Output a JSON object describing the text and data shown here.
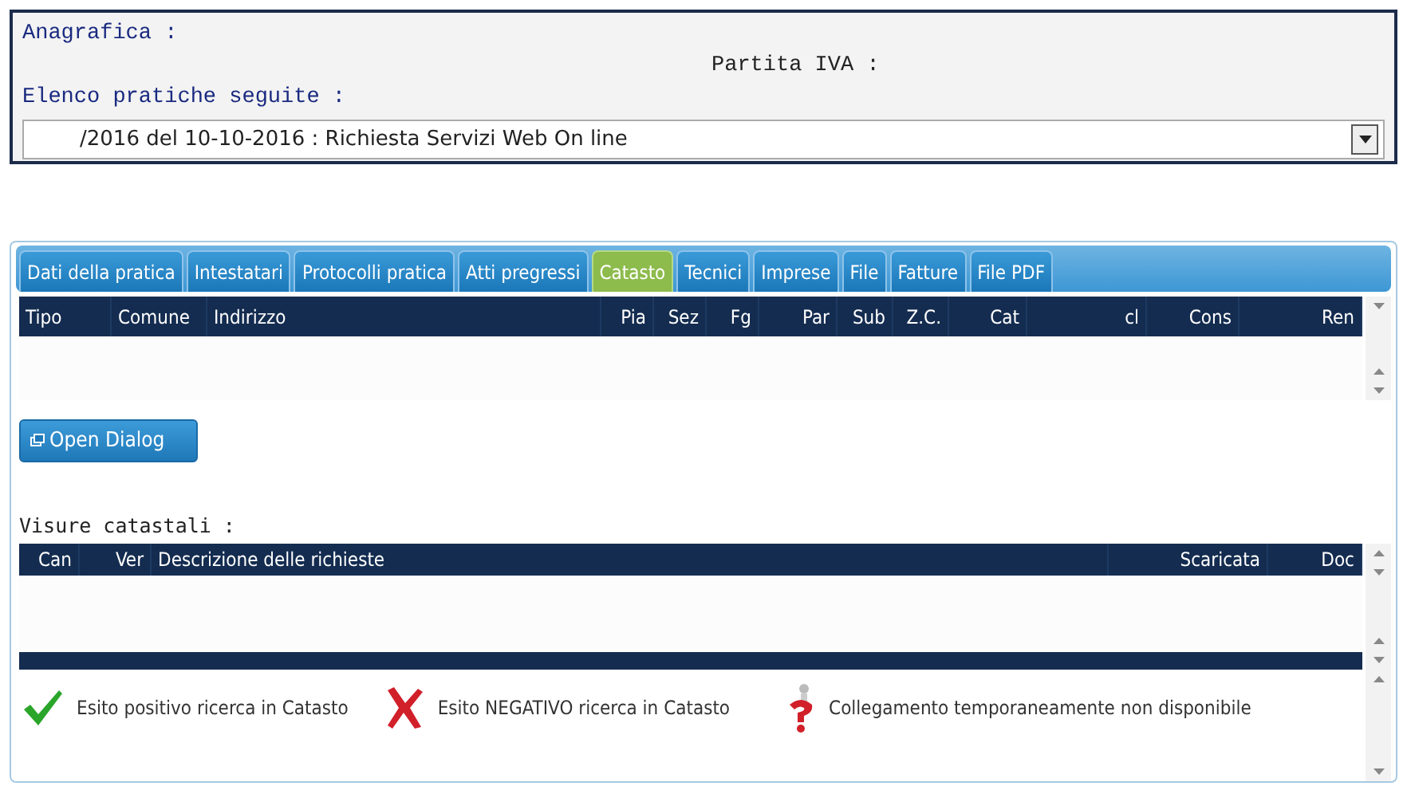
{
  "header": {
    "anagrafica_label": "Anagrafica :",
    "partita_iva_label": "Partita IVA :",
    "pratiche_label": "Elenco pratiche seguite :",
    "pratica_select": {
      "value": "/2016 del 10-10-2016 : Richiesta Servizi Web On line"
    }
  },
  "tabs": [
    {
      "label": "Dati della pratica",
      "selected": false
    },
    {
      "label": "Intestatari",
      "selected": false
    },
    {
      "label": "Protocolli pratica",
      "selected": false
    },
    {
      "label": "Atti pregressi",
      "selected": false
    },
    {
      "label": "Catasto",
      "selected": true
    },
    {
      "label": "Tecnici",
      "selected": false
    },
    {
      "label": "Imprese",
      "selected": false
    },
    {
      "label": "File",
      "selected": false
    },
    {
      "label": "Fatture",
      "selected": false
    },
    {
      "label": "File PDF",
      "selected": false
    }
  ],
  "immobili_table": {
    "columns": [
      "Tipo",
      "Comune",
      "Indirizzo",
      "Pia",
      "Sez",
      "Fg",
      "Par",
      "Sub",
      "Z.C.",
      "Cat",
      "cl",
      "Cons",
      "Ren"
    ]
  },
  "open_dialog_button": "Open Dialog",
  "visure_label": "Visure catastali :",
  "visure_table": {
    "columns": [
      "Can",
      "Ver",
      "Descrizione delle richieste",
      "Scaricata",
      "Doc"
    ]
  },
  "legend": [
    {
      "kind": "ok",
      "text": "Esito positivo ricerca in Catasto"
    },
    {
      "kind": "fail",
      "text": "Esito NEGATIVO ricerca in Catasto"
    },
    {
      "kind": "unknown",
      "text": "Collegamento temporaneamente non disponibile"
    }
  ]
}
